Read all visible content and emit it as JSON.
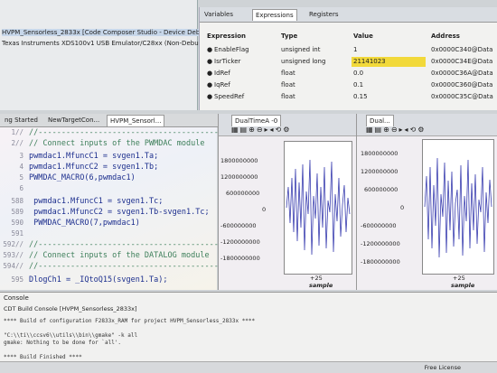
{
  "debug": {
    "lines": [
      "HVPM_Sensorless_2833x [Code Composer Studio - Device Debugging]",
      "Texas Instruments XDS100v1 USB Emulator/C28xx (Non-Debug)"
    ]
  },
  "expressions": {
    "tabs": [
      "Variables",
      "Expressions",
      "Registers"
    ],
    "headers": {
      "expression": "Expression",
      "type": "Type",
      "value": "Value",
      "address": "Address"
    },
    "rows": [
      {
        "expr": "EnableFlag",
        "type": "unsigned int",
        "value": "1",
        "address": "0x0000C340@Data"
      },
      {
        "expr": "IsrTicker",
        "type": "unsigned long",
        "value": "21141023",
        "address": "0x0000C34E@Data"
      },
      {
        "expr": "IdRef",
        "type": "float",
        "value": "0.0",
        "address": "0x0000C36A@Data"
      },
      {
        "expr": "IqRef",
        "type": "float",
        "value": "0.1",
        "address": "0x0000C360@Data"
      },
      {
        "expr": "SpeedRef",
        "type": "float",
        "value": "0.15",
        "address": "0x0000C35C@Data"
      }
    ]
  },
  "editor_tabs": [
    "ng Started",
    "NewTargetCon...",
    "HVPM_Sensorl..."
  ],
  "code": [
    {
      "ln": "1//",
      "text": "//------------------------------------------",
      "kind": "cm"
    },
    {
      "ln": "2//",
      "text": "//    Connect inputs of the PWMDAC module",
      "kind": "cm"
    },
    {
      "ln": "3",
      "text": "pwmdac1.MfuncC1 = svgen1.Ta;",
      "kind": "cd"
    },
    {
      "ln": "4",
      "text": "pwmdac1.MfuncC2 = svgen1.Tb;",
      "kind": "cd"
    },
    {
      "ln": "5",
      "text": "PWMDAC_MACRO(6,pwmdac1)",
      "kind": "cd"
    },
    {
      "ln": "6",
      "text": "",
      "kind": "cd"
    },
    {
      "ln": "588",
      "text": "  pwmdac1.MfuncC1 = svgen1.Tc;",
      "kind": "cd"
    },
    {
      "ln": "589",
      "text": "  pwmdac1.MfuncC2 = svgen1.Tb-svgen1.Tc;",
      "kind": "cd"
    },
    {
      "ln": "590",
      "text": "  PWMDAC_MACRO(7,pwmdac1)",
      "kind": "cd"
    },
    {
      "ln": "591",
      "text": "",
      "kind": "cd"
    },
    {
      "ln": "592//",
      "text": "//------------------------------------------",
      "kind": "cm"
    },
    {
      "ln": "593//",
      "text": "//    Connect inputs of the DATALOG module",
      "kind": "cm"
    },
    {
      "ln": "594//",
      "text": "//------------------------------------------",
      "kind": "cm"
    },
    {
      "ln": "595",
      "text": "DlogCh1 = _IQtoQ15(svgen1.Ta);",
      "kind": "cd"
    }
  ],
  "graph1": {
    "tab_label": "DualTimeA -0",
    "yticks": [
      "1800000000",
      "1200000000",
      "600000000",
      "0",
      "-600000000",
      "-1200000000",
      "-1800000000"
    ],
    "xtick": "+25",
    "xlabel": "sample"
  },
  "graph2": {
    "tab_label": "Dual...",
    "yticks": [
      "1800000000",
      "1200000000",
      "600000000",
      "0",
      "-600000000",
      "-1200000000",
      "-1800000000"
    ],
    "xtick": "+25",
    "xlabel": "sample"
  },
  "console": {
    "tab_label": "Console",
    "title": "CDT Build Console [HVPM_Sensorless_2833x]",
    "lines": [
      "**** Build of configuration F2833x_RAM for project HVPM_Sensorless_2833x ****",
      "",
      "\"C:\\\\ti\\\\ccsv6\\\\utils\\\\bin\\\\gmake\" -k all",
      "gmake: Nothing to be done for `all'.",
      "",
      "**** Build Finished ****"
    ]
  },
  "status": {
    "right": "Free License"
  }
}
